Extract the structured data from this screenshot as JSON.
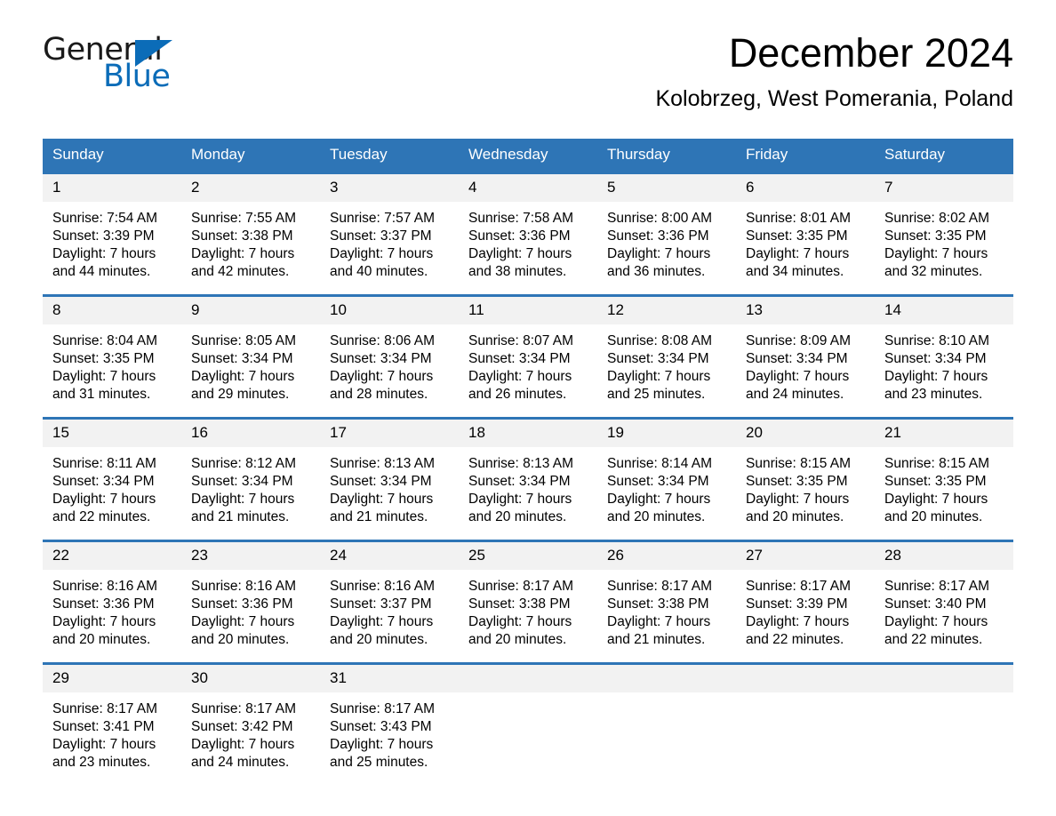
{
  "brand": {
    "name_top": "General",
    "name_bottom": "Blue",
    "triangle_color": "#0b6cb8"
  },
  "header": {
    "month_title": "December 2024",
    "location": "Kolobrzeg, West Pomerania, Poland"
  },
  "theme": {
    "header_blue": "#2e75b6",
    "row_border_blue": "#2e75b6",
    "daynum_strip": "#f2f2f2",
    "text": "#000000"
  },
  "calendar": {
    "weekday_headers": [
      "Sunday",
      "Monday",
      "Tuesday",
      "Wednesday",
      "Thursday",
      "Friday",
      "Saturday"
    ],
    "weeks": [
      [
        {
          "day": "1",
          "sunrise": "Sunrise: 7:54 AM",
          "sunset": "Sunset: 3:39 PM",
          "daylight1": "Daylight: 7 hours",
          "daylight2": "and 44 minutes."
        },
        {
          "day": "2",
          "sunrise": "Sunrise: 7:55 AM",
          "sunset": "Sunset: 3:38 PM",
          "daylight1": "Daylight: 7 hours",
          "daylight2": "and 42 minutes."
        },
        {
          "day": "3",
          "sunrise": "Sunrise: 7:57 AM",
          "sunset": "Sunset: 3:37 PM",
          "daylight1": "Daylight: 7 hours",
          "daylight2": "and 40 minutes."
        },
        {
          "day": "4",
          "sunrise": "Sunrise: 7:58 AM",
          "sunset": "Sunset: 3:36 PM",
          "daylight1": "Daylight: 7 hours",
          "daylight2": "and 38 minutes."
        },
        {
          "day": "5",
          "sunrise": "Sunrise: 8:00 AM",
          "sunset": "Sunset: 3:36 PM",
          "daylight1": "Daylight: 7 hours",
          "daylight2": "and 36 minutes."
        },
        {
          "day": "6",
          "sunrise": "Sunrise: 8:01 AM",
          "sunset": "Sunset: 3:35 PM",
          "daylight1": "Daylight: 7 hours",
          "daylight2": "and 34 minutes."
        },
        {
          "day": "7",
          "sunrise": "Sunrise: 8:02 AM",
          "sunset": "Sunset: 3:35 PM",
          "daylight1": "Daylight: 7 hours",
          "daylight2": "and 32 minutes."
        }
      ],
      [
        {
          "day": "8",
          "sunrise": "Sunrise: 8:04 AM",
          "sunset": "Sunset: 3:35 PM",
          "daylight1": "Daylight: 7 hours",
          "daylight2": "and 31 minutes."
        },
        {
          "day": "9",
          "sunrise": "Sunrise: 8:05 AM",
          "sunset": "Sunset: 3:34 PM",
          "daylight1": "Daylight: 7 hours",
          "daylight2": "and 29 minutes."
        },
        {
          "day": "10",
          "sunrise": "Sunrise: 8:06 AM",
          "sunset": "Sunset: 3:34 PM",
          "daylight1": "Daylight: 7 hours",
          "daylight2": "and 28 minutes."
        },
        {
          "day": "11",
          "sunrise": "Sunrise: 8:07 AM",
          "sunset": "Sunset: 3:34 PM",
          "daylight1": "Daylight: 7 hours",
          "daylight2": "and 26 minutes."
        },
        {
          "day": "12",
          "sunrise": "Sunrise: 8:08 AM",
          "sunset": "Sunset: 3:34 PM",
          "daylight1": "Daylight: 7 hours",
          "daylight2": "and 25 minutes."
        },
        {
          "day": "13",
          "sunrise": "Sunrise: 8:09 AM",
          "sunset": "Sunset: 3:34 PM",
          "daylight1": "Daylight: 7 hours",
          "daylight2": "and 24 minutes."
        },
        {
          "day": "14",
          "sunrise": "Sunrise: 8:10 AM",
          "sunset": "Sunset: 3:34 PM",
          "daylight1": "Daylight: 7 hours",
          "daylight2": "and 23 minutes."
        }
      ],
      [
        {
          "day": "15",
          "sunrise": "Sunrise: 8:11 AM",
          "sunset": "Sunset: 3:34 PM",
          "daylight1": "Daylight: 7 hours",
          "daylight2": "and 22 minutes."
        },
        {
          "day": "16",
          "sunrise": "Sunrise: 8:12 AM",
          "sunset": "Sunset: 3:34 PM",
          "daylight1": "Daylight: 7 hours",
          "daylight2": "and 21 minutes."
        },
        {
          "day": "17",
          "sunrise": "Sunrise: 8:13 AM",
          "sunset": "Sunset: 3:34 PM",
          "daylight1": "Daylight: 7 hours",
          "daylight2": "and 21 minutes."
        },
        {
          "day": "18",
          "sunrise": "Sunrise: 8:13 AM",
          "sunset": "Sunset: 3:34 PM",
          "daylight1": "Daylight: 7 hours",
          "daylight2": "and 20 minutes."
        },
        {
          "day": "19",
          "sunrise": "Sunrise: 8:14 AM",
          "sunset": "Sunset: 3:34 PM",
          "daylight1": "Daylight: 7 hours",
          "daylight2": "and 20 minutes."
        },
        {
          "day": "20",
          "sunrise": "Sunrise: 8:15 AM",
          "sunset": "Sunset: 3:35 PM",
          "daylight1": "Daylight: 7 hours",
          "daylight2": "and 20 minutes."
        },
        {
          "day": "21",
          "sunrise": "Sunrise: 8:15 AM",
          "sunset": "Sunset: 3:35 PM",
          "daylight1": "Daylight: 7 hours",
          "daylight2": "and 20 minutes."
        }
      ],
      [
        {
          "day": "22",
          "sunrise": "Sunrise: 8:16 AM",
          "sunset": "Sunset: 3:36 PM",
          "daylight1": "Daylight: 7 hours",
          "daylight2": "and 20 minutes."
        },
        {
          "day": "23",
          "sunrise": "Sunrise: 8:16 AM",
          "sunset": "Sunset: 3:36 PM",
          "daylight1": "Daylight: 7 hours",
          "daylight2": "and 20 minutes."
        },
        {
          "day": "24",
          "sunrise": "Sunrise: 8:16 AM",
          "sunset": "Sunset: 3:37 PM",
          "daylight1": "Daylight: 7 hours",
          "daylight2": "and 20 minutes."
        },
        {
          "day": "25",
          "sunrise": "Sunrise: 8:17 AM",
          "sunset": "Sunset: 3:38 PM",
          "daylight1": "Daylight: 7 hours",
          "daylight2": "and 20 minutes."
        },
        {
          "day": "26",
          "sunrise": "Sunrise: 8:17 AM",
          "sunset": "Sunset: 3:38 PM",
          "daylight1": "Daylight: 7 hours",
          "daylight2": "and 21 minutes."
        },
        {
          "day": "27",
          "sunrise": "Sunrise: 8:17 AM",
          "sunset": "Sunset: 3:39 PM",
          "daylight1": "Daylight: 7 hours",
          "daylight2": "and 22 minutes."
        },
        {
          "day": "28",
          "sunrise": "Sunrise: 8:17 AM",
          "sunset": "Sunset: 3:40 PM",
          "daylight1": "Daylight: 7 hours",
          "daylight2": "and 22 minutes."
        }
      ],
      [
        {
          "day": "29",
          "sunrise": "Sunrise: 8:17 AM",
          "sunset": "Sunset: 3:41 PM",
          "daylight1": "Daylight: 7 hours",
          "daylight2": "and 23 minutes."
        },
        {
          "day": "30",
          "sunrise": "Sunrise: 8:17 AM",
          "sunset": "Sunset: 3:42 PM",
          "daylight1": "Daylight: 7 hours",
          "daylight2": "and 24 minutes."
        },
        {
          "day": "31",
          "sunrise": "Sunrise: 8:17 AM",
          "sunset": "Sunset: 3:43 PM",
          "daylight1": "Daylight: 7 hours",
          "daylight2": "and 25 minutes."
        },
        {
          "day": "",
          "sunrise": "",
          "sunset": "",
          "daylight1": "",
          "daylight2": ""
        },
        {
          "day": "",
          "sunrise": "",
          "sunset": "",
          "daylight1": "",
          "daylight2": ""
        },
        {
          "day": "",
          "sunrise": "",
          "sunset": "",
          "daylight1": "",
          "daylight2": ""
        },
        {
          "day": "",
          "sunrise": "",
          "sunset": "",
          "daylight1": "",
          "daylight2": ""
        }
      ]
    ]
  }
}
